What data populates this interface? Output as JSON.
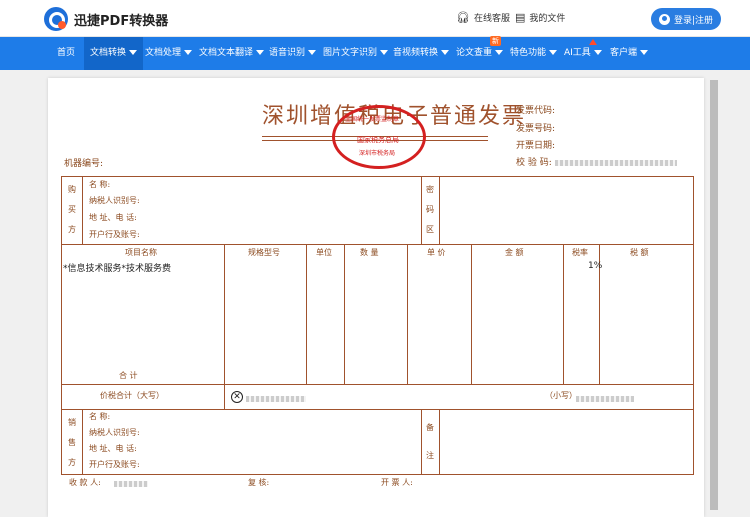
{
  "app": {
    "name": "迅捷PDF转换器"
  },
  "header": {
    "online_service": "在线客服",
    "my_files": "我的文件",
    "login": "登录|注册"
  },
  "nav": {
    "items": [
      {
        "label": "首页",
        "active": false
      },
      {
        "label": "文档转换",
        "active": true
      },
      {
        "label": "文档处理",
        "active": false
      },
      {
        "label": "文档文本翻译",
        "active": false
      },
      {
        "label": "语音识别",
        "active": false
      },
      {
        "label": "图片文字识别",
        "active": false
      },
      {
        "label": "音视频转换",
        "active": false
      },
      {
        "label": "论文查重",
        "active": false
      },
      {
        "label": "特色功能",
        "active": false
      },
      {
        "label": "AI工具",
        "active": false
      },
      {
        "label": "客户端",
        "active": false
      }
    ],
    "new_badge": "新"
  },
  "invoice": {
    "title": "深圳增值税电子普通发票",
    "seal": {
      "top": "全国统一发票监制章",
      "middle": "国家税务总局",
      "bottom": "深圳市税务局"
    },
    "meta": {
      "code": "发票代码:",
      "number": "发票号码:",
      "date": "开票日期:",
      "check": "校 验 码:"
    },
    "machine_no": "机器编号:",
    "buyer": {
      "side": [
        "购",
        "买",
        "方"
      ],
      "name": "名      称:",
      "tax_id": "纳税人识别号:",
      "address": "地 址、电 话:",
      "bank": "开户行及账号:"
    },
    "password_area": [
      "密",
      "码",
      "区"
    ],
    "columns": {
      "item": "项目名称",
      "spec": "规格型号",
      "unit": "单位",
      "qty": "数  量",
      "price": "单  价",
      "amount": "金  额",
      "rate": "税率",
      "tax": "税  额"
    },
    "item_row": {
      "name": "*信息技术服务*技术服务费",
      "rate": "1%"
    },
    "total_label": "合          计",
    "total_tax_label": "价税合计（大写）",
    "total_small_label": "（小写）",
    "seller": {
      "side": [
        "销",
        "售",
        "方"
      ],
      "name": "名      称:",
      "tax_id": "纳税人识别号:",
      "address": "地 址、电 话:",
      "bank": "开户行及账号:"
    },
    "remark": [
      "备",
      "注"
    ],
    "footer": {
      "payee": "收 款 人:",
      "reviewer": "复    核:",
      "drawer": "开 票 人:"
    }
  }
}
